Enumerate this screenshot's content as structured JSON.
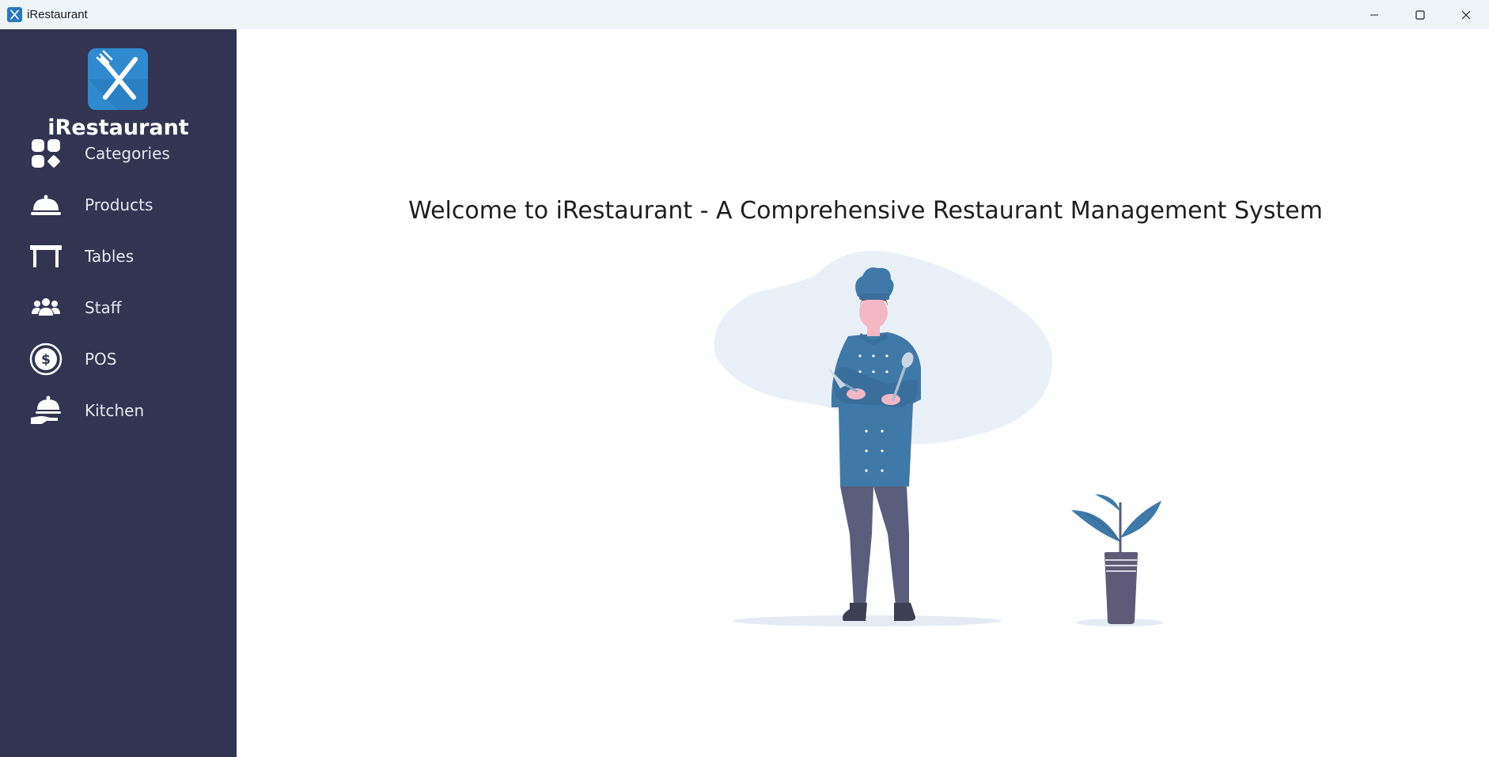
{
  "window": {
    "title": "iRestaurant",
    "controls": [
      "minimize",
      "maximize",
      "close"
    ]
  },
  "sidebar": {
    "brand": "iRestaurant",
    "logo_icon": "fork-knife-icon",
    "items": [
      {
        "label": "Categories",
        "icon": "categories-icon"
      },
      {
        "label": "Products",
        "icon": "cloche-icon"
      },
      {
        "label": "Tables",
        "icon": "table-icon"
      },
      {
        "label": "Staff",
        "icon": "staff-icon"
      },
      {
        "label": "POS",
        "icon": "dollar-coin-icon"
      },
      {
        "label": "Kitchen",
        "icon": "serving-hand-icon"
      }
    ]
  },
  "main": {
    "welcome": "Welcome to iRestaurant - A Comprehensive Restaurant Management System",
    "illustration": "chef-illustration"
  },
  "colors": {
    "sidebar_bg": "#323452",
    "titlebar_bg": "#eef4f8",
    "accent_blue": "#3f79a8",
    "logo_blue": "#2f8ad0"
  }
}
